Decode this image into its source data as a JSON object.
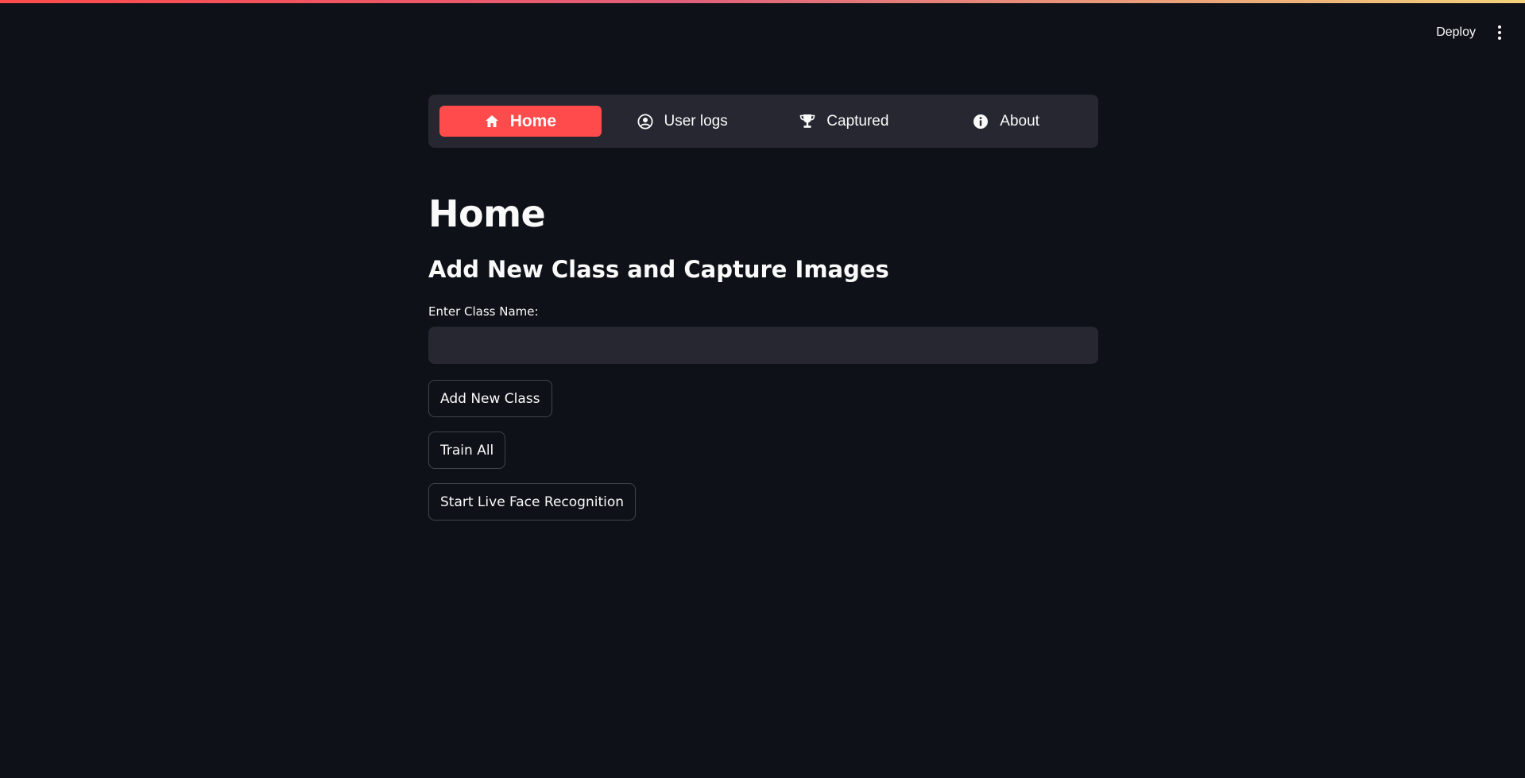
{
  "header": {
    "deploy_label": "Deploy",
    "menu_icon": "kebab-menu-icon"
  },
  "colors": {
    "accent": "#ff4b4b",
    "background": "#0e1117",
    "surface": "#262730",
    "text": "#fafafa"
  },
  "nav": {
    "items": [
      {
        "label": "Home",
        "icon": "home-icon",
        "active": true
      },
      {
        "label": "User logs",
        "icon": "user-circle-icon",
        "active": false
      },
      {
        "label": "Captured",
        "icon": "trophy-icon",
        "active": false
      },
      {
        "label": "About",
        "icon": "info-icon",
        "active": false
      }
    ]
  },
  "main": {
    "title": "Home",
    "subtitle": "Add New Class and Capture Images",
    "class_name_label": "Enter Class Name:",
    "class_name_value": "",
    "class_name_placeholder": "",
    "buttons": {
      "add_class": "Add New Class",
      "train_all": "Train All",
      "live_recognition": "Start Live Face Recognition"
    }
  }
}
